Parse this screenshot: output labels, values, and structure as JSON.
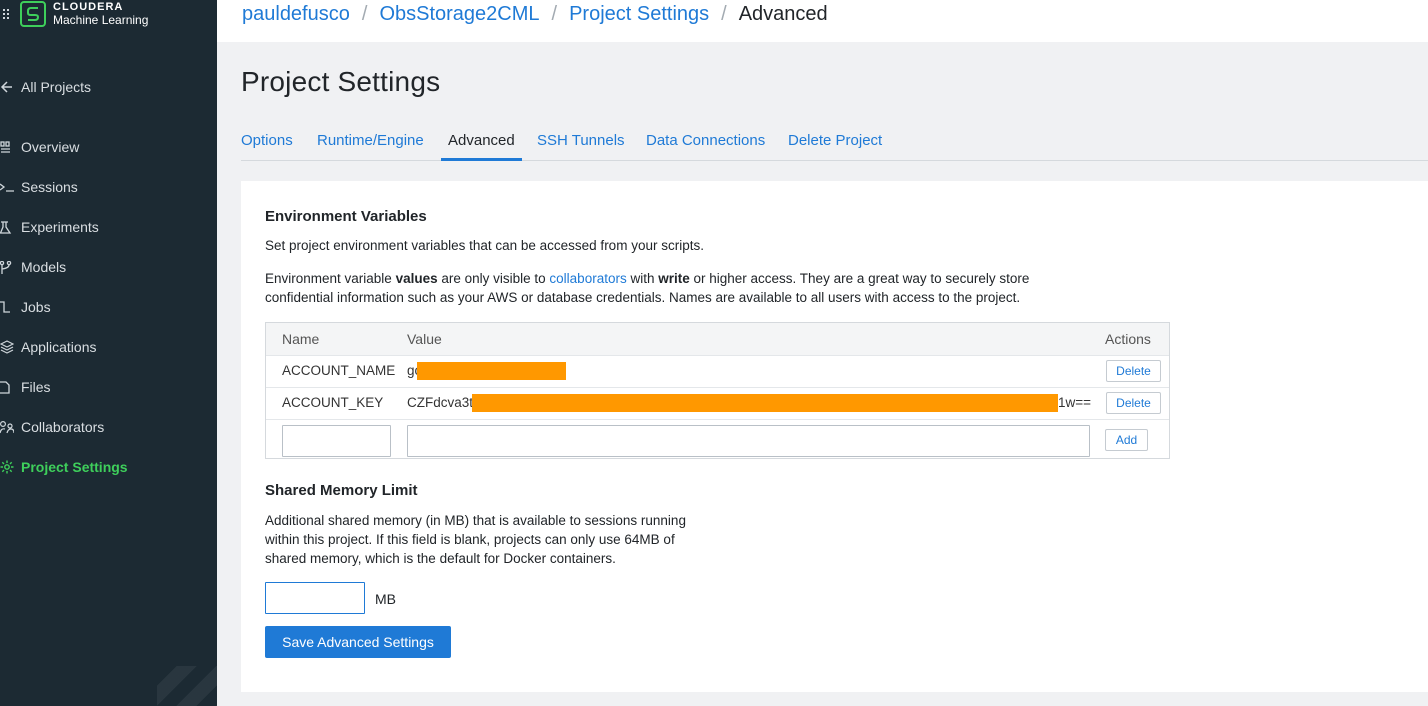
{
  "brand": {
    "name": "CLOUDERA",
    "product": "Machine Learning"
  },
  "sidebar": {
    "items": [
      {
        "label": "All Projects",
        "icon": "arrow-left-icon"
      },
      {
        "label": "Overview",
        "icon": "overview-icon"
      },
      {
        "label": "Sessions",
        "icon": "terminal-icon"
      },
      {
        "label": "Experiments",
        "icon": "flask-icon"
      },
      {
        "label": "Models",
        "icon": "model-icon"
      },
      {
        "label": "Jobs",
        "icon": "jobs-icon"
      },
      {
        "label": "Applications",
        "icon": "layers-icon"
      },
      {
        "label": "Files",
        "icon": "file-icon"
      },
      {
        "label": "Collaborators",
        "icon": "users-icon"
      },
      {
        "label": "Project Settings",
        "icon": "gear-icon",
        "active": true
      }
    ]
  },
  "breadcrumb": {
    "user": "pauldefusco",
    "project": "ObsStorage2CML",
    "section": "Project Settings",
    "current": "Advanced"
  },
  "page": {
    "title": "Project Settings"
  },
  "tabs": [
    {
      "label": "Options"
    },
    {
      "label": "Runtime/Engine"
    },
    {
      "label": "Advanced",
      "active": true
    },
    {
      "label": "SSH Tunnels"
    },
    {
      "label": "Data Connections"
    },
    {
      "label": "Delete Project"
    }
  ],
  "env": {
    "heading": "Environment Variables",
    "intro": "Set project environment variables that can be accessed from your scripts.",
    "desc": {
      "t1": "Environment variable ",
      "b1": "values",
      "t2": " are only visible to ",
      "link": "collaborators",
      "t3": " with ",
      "b2": "write",
      "t4": " or higher access. They are a great way to securely store confidential information such as your AWS or database credentials. Names are available to all users with access to the project."
    },
    "columns": {
      "name": "Name",
      "value": "Value",
      "actions": "Actions"
    },
    "rows": [
      {
        "name": "ACCOUNT_NAME",
        "value_prefix": "go",
        "value_suffix": "",
        "action": "Delete"
      },
      {
        "name": "ACCOUNT_KEY",
        "value_prefix": "CZFdcva3t",
        "value_suffix": "1w==",
        "action": "Delete"
      }
    ],
    "new_row": {
      "name_value": "",
      "value_value": "",
      "action": "Add"
    }
  },
  "shm": {
    "heading": "Shared Memory Limit",
    "desc": "Additional shared memory (in MB) that is available to sessions running within this project. If this field is blank, projects can only use 64MB of shared memory, which is the default for Docker containers.",
    "value": "",
    "unit": "MB"
  },
  "save_label": "Save Advanced Settings",
  "colors": {
    "accent": "#1f7ad6",
    "brand_green": "#3ecf5b",
    "sidebar_bg": "#1c2a33",
    "redaction": "#ff9800"
  }
}
